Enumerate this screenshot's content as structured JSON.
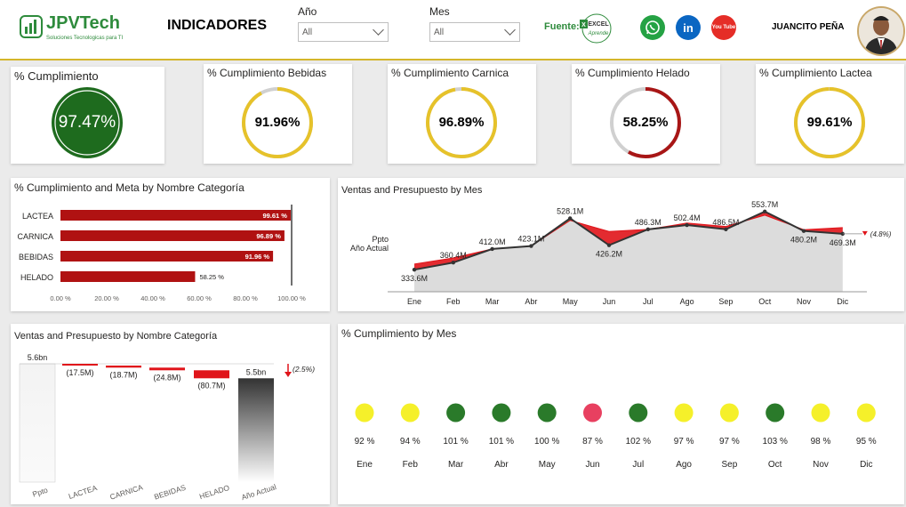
{
  "header": {
    "brand": "JPVTech",
    "brand_sub": "Soluciones Tecnologicas para TI",
    "title": "INDICADORES",
    "filters": [
      {
        "label": "Año",
        "value": "All"
      },
      {
        "label": "Mes",
        "value": "All"
      }
    ],
    "fuente_label": "Fuente:",
    "fuente_badge_top": "EXCEL",
    "fuente_badge_bottom": "Aprende",
    "social": [
      {
        "name": "whatsapp",
        "color": "#25a244"
      },
      {
        "name": "linkedin",
        "color": "#0a66c2",
        "text": "in"
      },
      {
        "name": "youtube",
        "color": "#e52d27",
        "text": "You Tube"
      }
    ],
    "user_name": "JUANCITO PEÑA"
  },
  "kpis": {
    "main": {
      "title": "% Cumplimiento",
      "value": "97.47%",
      "fraction": 0.9747,
      "color": "#1e6b1e"
    },
    "cards": [
      {
        "title": "% Cumplimiento Bebidas",
        "value": "91.96%",
        "fraction": 0.9196,
        "color": "#e6c22a"
      },
      {
        "title": "% Cumplimiento Carnica",
        "value": "96.89%",
        "fraction": 0.9689,
        "color": "#e6c22a"
      },
      {
        "title": "% Cumplimiento Helado",
        "value": "58.25%",
        "fraction": 0.5825,
        "color": "#a81616"
      },
      {
        "title": "% Cumplimiento Lactea",
        "value": "99.61%",
        "fraction": 0.9961,
        "color": "#e6c22a"
      }
    ]
  },
  "bar_chart": {
    "title": "% Cumplimiento and Meta by Nombre Categoría",
    "bar_color": "#b01212",
    "meta_color": "#404040"
  },
  "line_chart": {
    "title": "Ventas and Presupuesto by Mes",
    "legend": [
      "Ppto",
      "Año Actual"
    ],
    "end_delta": "(4.8%)"
  },
  "waterfall": {
    "title": "Ventas and Presupuesto by Nombre Categoría",
    "end_delta": "(2.5%)"
  },
  "dots": {
    "title": "% Cumplimiento by Mes"
  },
  "chart_data": [
    {
      "type": "bar",
      "title": "% Cumplimiento and Meta by Nombre Categoría",
      "categories": [
        "LACTEA",
        "CARNICA",
        "BEBIDAS",
        "HELADO"
      ],
      "values": [
        99.61,
        96.89,
        91.96,
        58.25
      ],
      "labels": [
        "99.61 %",
        "96.89 %",
        "91.96 %",
        "58.25 %"
      ],
      "meta": 100,
      "xticks": [
        "0.00 %",
        "20.00 %",
        "40.00 %",
        "60.00 %",
        "80.00 %",
        "100.00 %"
      ],
      "xlim": [
        0,
        100
      ]
    },
    {
      "type": "line",
      "title": "Ventas and Presupuesto by Mes",
      "categories": [
        "Ene",
        "Feb",
        "Mar",
        "Abr",
        "May",
        "Jun",
        "Jul",
        "Ago",
        "Sep",
        "Oct",
        "Nov",
        "Dic"
      ],
      "series": [
        {
          "name": "Año Actual",
          "values": [
            333.6,
            360.4,
            412.0,
            423.1,
            528.1,
            426.2,
            486.3,
            502.4,
            486.5,
            553.7,
            480.2,
            469.3
          ]
        },
        {
          "name": "Ppto",
          "values": [
            355,
            378,
            412,
            423,
            520,
            478,
            486,
            510,
            497,
            540,
            485,
            493
          ]
        }
      ],
      "labels": [
        "333.6M",
        "360.4M",
        "412.0M",
        "423.1M",
        "528.1M",
        "426.2M",
        "486.3M",
        "502.4M",
        "486.5M",
        "553.7M",
        "480.2M",
        "469.3M"
      ],
      "ylim": [
        0,
        600
      ]
    },
    {
      "type": "bar",
      "title": "Ventas and Presupuesto by Nombre Categoría",
      "categories": [
        "Ppto",
        "LACTEA",
        "CARNICA",
        "BEBIDAS",
        "HELADO",
        "Año Actual"
      ],
      "values": [
        5.6,
        -0.0175,
        -0.0187,
        -0.0248,
        -0.0807,
        5.5
      ],
      "labels": [
        "5.6bn",
        "(17.5M)",
        "(18.7M)",
        "(24.8M)",
        "(80.7M)",
        "5.5bn"
      ]
    },
    {
      "type": "scatter",
      "title": "% Cumplimiento by Mes",
      "categories": [
        "Ene",
        "Feb",
        "Mar",
        "Abr",
        "May",
        "Jun",
        "Jul",
        "Ago",
        "Sep",
        "Oct",
        "Nov",
        "Dic"
      ],
      "values": [
        92,
        94,
        101,
        101,
        100,
        87,
        102,
        97,
        97,
        103,
        98,
        95
      ],
      "labels": [
        "92 %",
        "94 %",
        "101 %",
        "101 %",
        "100 %",
        "87 %",
        "102 %",
        "97 %",
        "97 %",
        "103 %",
        "98 %",
        "95 %"
      ],
      "colors": [
        "#f5f02a",
        "#f5f02a",
        "#2a7a2a",
        "#2a7a2a",
        "#2a7a2a",
        "#e84060",
        "#2a7a2a",
        "#f5f02a",
        "#f5f02a",
        "#2a7a2a",
        "#f5f02a",
        "#f5f02a"
      ]
    }
  ]
}
